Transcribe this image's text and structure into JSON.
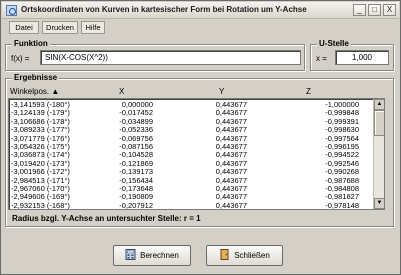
{
  "window": {
    "title": "Ortskoordinaten von Kurven in kartesischer Form bei Rotation um Y-Achse",
    "controls": [
      "_",
      "□",
      "X"
    ]
  },
  "menu": [
    "Datei",
    "Drucken",
    "Hilfe"
  ],
  "funktion": {
    "group_title": "Funktion",
    "label": "f(x) =",
    "value": "SIN(X-COS(X^2))"
  },
  "ustelle": {
    "group_title": "U-Stelle",
    "label": "x =",
    "value": "1,000"
  },
  "ergebnisse": {
    "group_title": "Ergebnisse",
    "columns": [
      "Winkelpos. ▲",
      "X",
      "Y",
      "Z"
    ],
    "rows": [
      [
        "-3,141593 (-180°)",
        "0,000000",
        "0,443677",
        "-1,000000"
      ],
      [
        "-3,124139 (-179°)",
        "-0,017452",
        "0,443677",
        "-0,999848"
      ],
      [
        "-3,106686 (-178°)",
        "-0,034899",
        "0,443677",
        "-0,999391"
      ],
      [
        "-3,089233 (-177°)",
        "-0,052336",
        "0,443677",
        "-0,998630"
      ],
      [
        "-3,071779 (-176°)",
        "-0,069756",
        "0,443677",
        "-0,997564"
      ],
      [
        "-3,054326 (-175°)",
        "-0,087156",
        "0,443677",
        "-0,996195"
      ],
      [
        "-3,036873 (-174°)",
        "-0,104528",
        "0,443677",
        "-0,994522"
      ],
      [
        "-3,019420 (-173°)",
        "-0,121869",
        "0,443677",
        "-0,992546"
      ],
      [
        "-3,001966 (-172°)",
        "-0,139173",
        "0,443677",
        "-0,990268"
      ],
      [
        "-2,984513 (-171°)",
        "-0,156434",
        "0,443677",
        "-0,987688"
      ],
      [
        "-2,967060 (-170°)",
        "-0,173648",
        "0,443677",
        "-0,984808"
      ],
      [
        "-2,949606 (-169°)",
        "-0,190809",
        "0,443677",
        "-0,981627"
      ],
      [
        "-2,932153 (-168°)",
        "-0,207912",
        "0,443677",
        "-0,978148"
      ]
    ],
    "footer": "Radius bzgl. Y-Achse an untersuchter Stelle:  r = 1"
  },
  "buttons": {
    "berechnen": "Berechnen",
    "schliessen": "Schließen"
  }
}
